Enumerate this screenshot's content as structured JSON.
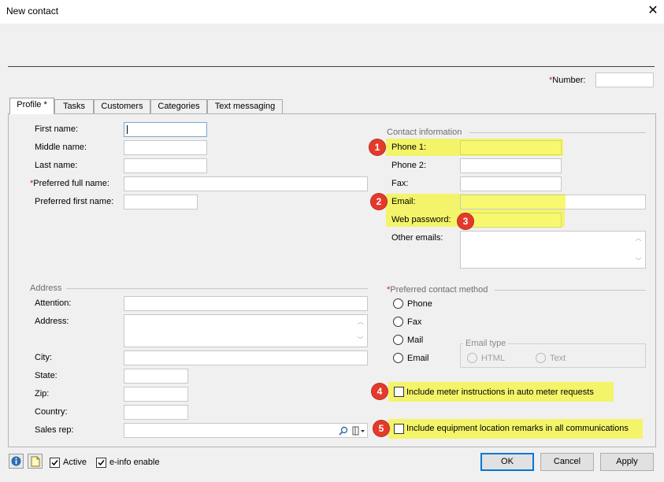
{
  "window": {
    "title": "New contact",
    "close_glyph": "✕"
  },
  "header": {
    "number_label": "Number:",
    "required_mark": "*",
    "number_value": ""
  },
  "tabs": [
    "Profile *",
    "Tasks",
    "Customers",
    "Categories",
    "Text messaging"
  ],
  "profile": {
    "first_name_label": "First name:",
    "middle_name_label": "Middle name:",
    "last_name_label": "Last name:",
    "preferred_full_name_label": "Preferred full name:",
    "preferred_first_name_label": "Preferred first name:"
  },
  "contact_info": {
    "group_label": "Contact information",
    "phone1_label": "Phone 1:",
    "phone2_label": "Phone 2:",
    "fax_label": "Fax:",
    "email_label": "Email:",
    "web_password_label": "Web password:",
    "other_emails_label": "Other emails:"
  },
  "address": {
    "group_label": "Address",
    "attention_label": "Attention:",
    "address_label": "Address:",
    "city_label": "City:",
    "state_label": "State:",
    "zip_label": "Zip:",
    "country_label": "Country:",
    "sales_rep_label": "Sales rep:"
  },
  "preferred_contact": {
    "group_label": "Preferred contact method",
    "options": [
      "Phone",
      "Fax",
      "Mail",
      "Email"
    ],
    "email_type_label": "Email type",
    "email_types": [
      "HTML",
      "Text"
    ]
  },
  "options": {
    "meter_instructions_label": "Include meter instructions in auto meter requests",
    "equipment_remarks_label": "Include equipment location remarks in all communications"
  },
  "annotations": [
    "1",
    "2",
    "3",
    "4",
    "5"
  ],
  "colors": {
    "highlight": "#f4f46a",
    "badge": "#e33a2c",
    "required": "#d0191b",
    "ok_border": "#0078d7"
  },
  "footer": {
    "active_label": "Active",
    "einfo_label": "e-info enable",
    "ok_label": "OK",
    "cancel_label": "Cancel",
    "apply_label": "Apply"
  },
  "icons": {
    "info": "info-icon",
    "notes": "notes-icon",
    "search": "search-icon",
    "dropdown": "dropdown-icon"
  }
}
